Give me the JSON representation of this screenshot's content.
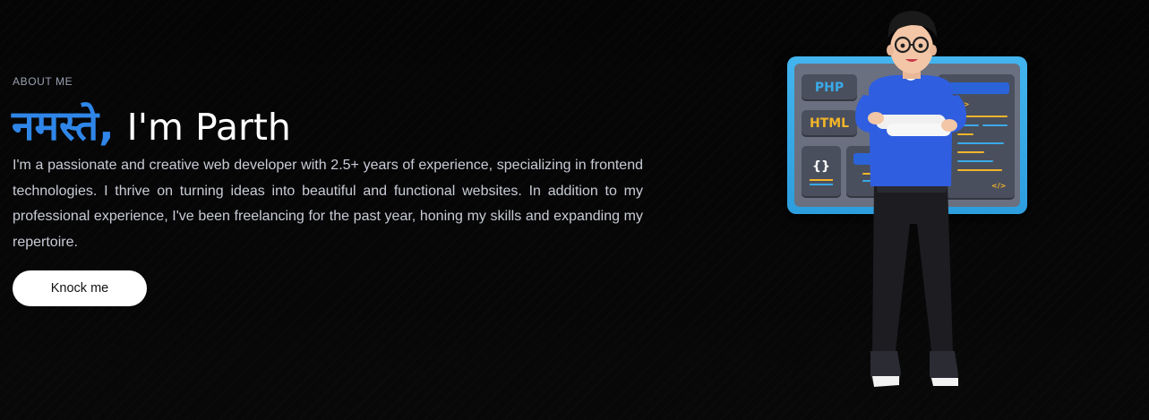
{
  "section": {
    "label": "ABOUT ME"
  },
  "headline": {
    "greeting": "नमस्ते,",
    "name": "I'm Parth"
  },
  "intro_text": "I'm a passionate and creative web developer with 2.5+ years of experience, specializing in frontend technologies. I thrive on turning ideas into beautiful and functional websites. In addition to my professional experience, I've been freelancing for the past year, honing my skills and expanding my repertoire.",
  "cta": {
    "label": "Knock me"
  },
  "illustration": {
    "tile_labels": {
      "php": "PHP",
      "html": "HTML",
      "braces": "{}",
      "tag_small": "<>",
      "tag_close": "</>"
    }
  },
  "colors": {
    "background": "#070707",
    "accent_blue": "#2f86e8",
    "text_primary": "#ffffff",
    "text_body": "#c9ccd6",
    "button_bg": "#ffffff"
  }
}
